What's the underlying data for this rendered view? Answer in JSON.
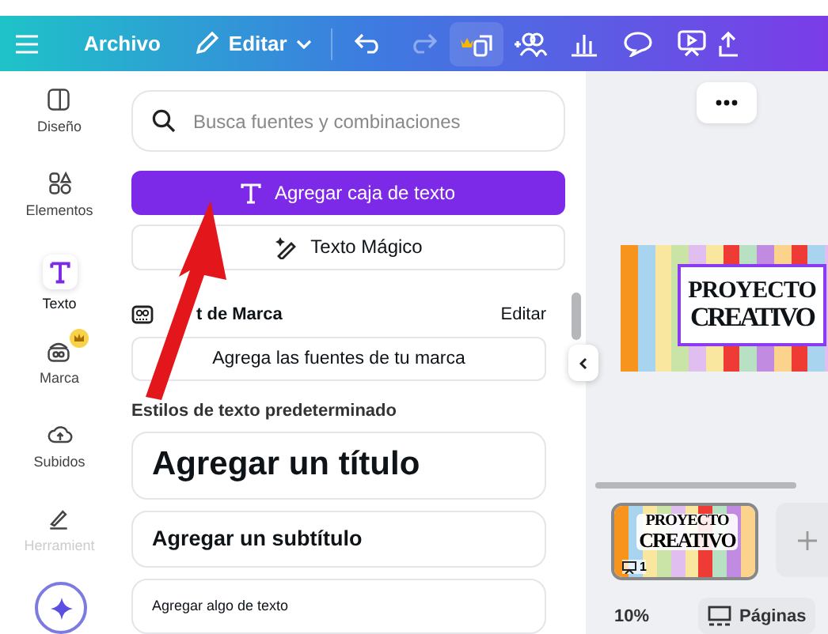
{
  "toolbar": {
    "file_menu": "Archivo",
    "edit_menu": "Editar",
    "undo": {
      "disabled": false
    },
    "redo": {
      "disabled": true
    }
  },
  "rail": [
    {
      "label": "Diseño",
      "selected": false,
      "premium": false
    },
    {
      "label": "Elementos",
      "selected": false,
      "premium": false
    },
    {
      "label": "Texto",
      "selected": true,
      "premium": false
    },
    {
      "label": "Marca",
      "selected": false,
      "premium": true
    },
    {
      "label": "Subidos",
      "selected": false,
      "premium": false
    },
    {
      "label": "Herramient",
      "selected": false,
      "premium": false
    }
  ],
  "panel": {
    "search": {
      "placeholder": "Busca fuentes y combinaciones"
    },
    "add_textbox_button": "Agregar caja de texto",
    "magic_text_button": "Texto Mágico",
    "brand_kit": {
      "title": "t de Marca",
      "edit_link": "Editar",
      "add_fonts_button": "Agrega las fuentes de tu marca"
    },
    "styles_heading": "Estilos de texto predeterminado",
    "styles": [
      {
        "kind": "heading",
        "text": "Agregar un título"
      },
      {
        "kind": "subheading",
        "text": "Agregar un subtítulo"
      },
      {
        "kind": "body",
        "text": "Agregar algo de texto"
      }
    ]
  },
  "canvas": {
    "design": {
      "lines": [
        "PROYECTO",
        "CREATIVO"
      ],
      "selected": true
    },
    "page_thumbnail": {
      "lines": [
        "PROYECTO",
        "CREATIVO"
      ],
      "page_number": "1",
      "selected": true
    },
    "zoom": "10%",
    "pages_button": "Páginas"
  }
}
